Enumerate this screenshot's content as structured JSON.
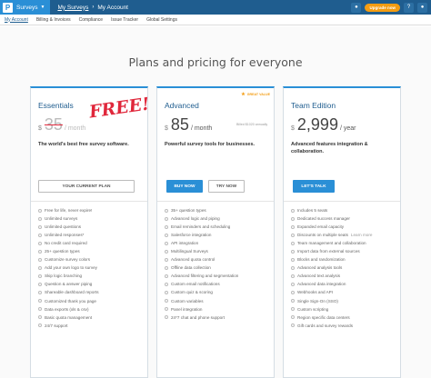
{
  "topbar": {
    "brand_logo": "P",
    "brand_name": "Surveys",
    "crumb_link": "My Surveys",
    "crumb_sep": "›",
    "crumb_current": "My Account",
    "upgrade_label": "Upgrade now",
    "icons": [
      "bell-icon",
      "question-icon",
      "user-icon"
    ],
    "accent": "#2a8fd6"
  },
  "subnav": {
    "items": [
      "My Account",
      "Billing & Invoices",
      "Compliance",
      "Issue Tracker",
      "Global Settings"
    ]
  },
  "page": {
    "headline": "Plans and pricing for everyone"
  },
  "plans": [
    {
      "title": "Essentials",
      "currency": "$",
      "amount": "35",
      "per": "/ month",
      "free_label": "FREE!",
      "description": "The world's best free survey software.",
      "buttons": [
        "YOUR CURRENT PLAN"
      ],
      "features": [
        "Free for life, never expire!",
        "Unlimited surveys",
        "Unlimited questions",
        "Unlimited responses*",
        "No credit card required",
        "25+ question types",
        "Customize survey colors",
        "Add your own logo to survey",
        "Skip logic branching",
        "Question & answer piping",
        "Shareable dashboard reports",
        "Customized thank you page",
        "Data exports (xls & csv)",
        "Basic quota management",
        "24/7 support"
      ]
    },
    {
      "title": "Advanced",
      "tag": "GREAT VALUE",
      "currency": "$",
      "amount": "85",
      "per": "/ month",
      "billed_note": "Billed $1020 annually",
      "description": "Powerful survey tools for businesses.",
      "buttons": [
        "BUY NOW",
        "TRY NOW"
      ],
      "features": [
        "35+ question types",
        "Advanced logic and piping",
        "Email reminders and scheduling",
        "Salesforce integration",
        "API integration",
        "Multilingual Surveys",
        "Advanced quota control",
        "Offline data collection",
        "Advanced filtering and segmentation",
        "Custom email notifications",
        "Custom quiz & scoring",
        "Custom variables",
        "Panel integration",
        "24*7 chat and phone support"
      ]
    },
    {
      "title": "Team Edition",
      "currency": "$",
      "amount": "2,999",
      "per": "/ year",
      "description": "Advanced features integration & collaboration.",
      "buttons": [
        "LET'S TALK"
      ],
      "features": [
        "Includes 5 seats",
        "Dedicated success manager",
        "Expanded email capacity",
        "Discounts on multiple seats",
        "Team management and collaboration",
        "Import data from external sources",
        "Blocks and randomization",
        "Advanced analysis tools",
        "Advanced text analysis",
        "Advanced data integration",
        "Webhooks and API",
        "Single Sign-On (SSO)",
        "Custom scripting",
        "Region specific data centers",
        "Gift cards and survey rewards"
      ],
      "learn_more": "Learn more"
    }
  ]
}
